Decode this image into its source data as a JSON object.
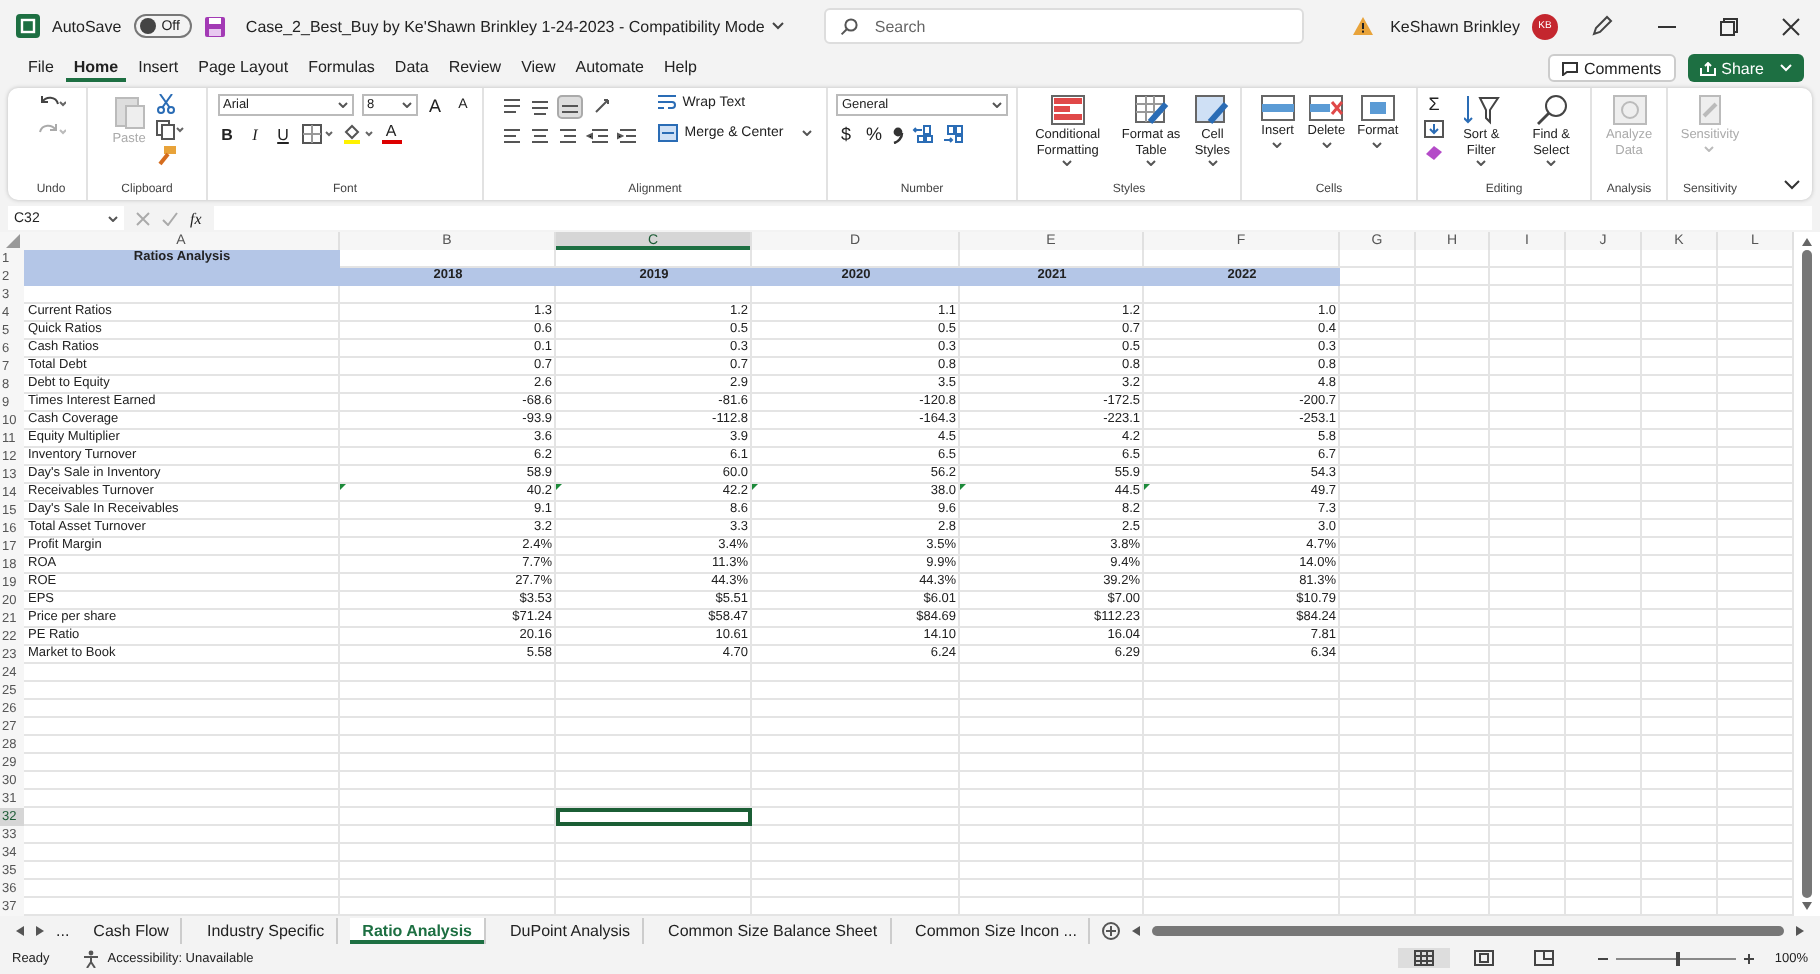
{
  "title_bar": {
    "autosave_label": "AutoSave",
    "autosave": {
      "on": false,
      "label": "Off"
    },
    "document_title": "Case_2_Best_Buy by Ke'Shawn Brinkley 1-24-2023  -  Compatibility Mode",
    "search": {
      "placeholder": "Search"
    },
    "user_name": "KeShawn Brinkley",
    "avatar_initials": "KB"
  },
  "menu_tabs": [
    {
      "label": "File",
      "selected": false
    },
    {
      "label": "Home",
      "selected": true
    },
    {
      "label": "Insert",
      "selected": false
    },
    {
      "label": "Page Layout",
      "selected": false
    },
    {
      "label": "Formulas",
      "selected": false
    },
    {
      "label": "Data",
      "selected": false
    },
    {
      "label": "Review",
      "selected": false
    },
    {
      "label": "View",
      "selected": false
    },
    {
      "label": "Automate",
      "selected": false
    },
    {
      "label": "Help",
      "selected": false
    }
  ],
  "comments_button": "Comments",
  "share_button": "Share",
  "ribbon": {
    "undo": {
      "label": "Undo"
    },
    "clipboard": {
      "label": "Clipboard",
      "paste": "Paste"
    },
    "font": {
      "label": "Font",
      "font_name": "Arial",
      "font_size": "8",
      "grow": "A",
      "shrink": "A",
      "bold": "B",
      "italic": "I",
      "underline": "U",
      "font_color": "A"
    },
    "alignment": {
      "label": "Alignment",
      "wrap_text": "Wrap Text",
      "merge_center": "Merge & Center"
    },
    "number": {
      "label": "Number",
      "format": "General",
      "currency": "$",
      "percent": "%"
    },
    "styles": {
      "label": "Styles",
      "buttons": [
        "Conditional Formatting",
        "Format as Table",
        "Cell Styles"
      ]
    },
    "cells": {
      "label": "Cells",
      "buttons": [
        "Insert",
        "Delete",
        "Format"
      ]
    },
    "editing": {
      "label": "Editing",
      "sum": "Σ",
      "buttons": [
        "Sort & Filter",
        "Find & Select"
      ]
    },
    "analysis": {
      "label": "Analysis",
      "button": {
        "label": "Analyze Data",
        "disabled": true
      }
    },
    "sensitivity": {
      "label": "Sensitivity",
      "button": {
        "label": "Sensitivity",
        "disabled": true
      }
    }
  },
  "formula_bar": {
    "name_box": "C32",
    "fx": "fx"
  },
  "sheet": {
    "columns": [
      {
        "label": "A",
        "selected": false
      },
      {
        "label": "B",
        "selected": false
      },
      {
        "label": "C",
        "selected": true
      },
      {
        "label": "D",
        "selected": false
      },
      {
        "label": "E",
        "selected": false
      },
      {
        "label": "F",
        "selected": false
      },
      {
        "label": "G",
        "selected": false
      },
      {
        "label": "H",
        "selected": false
      },
      {
        "label": "I",
        "selected": false
      },
      {
        "label": "J",
        "selected": false
      },
      {
        "label": "K",
        "selected": false
      },
      {
        "label": "L",
        "selected": false
      }
    ],
    "rows": [
      {
        "number": "1",
        "kind": "title",
        "selected": false,
        "title": "Ratios Analysis"
      },
      {
        "number": "2",
        "kind": "years",
        "selected": false,
        "years": [
          "2018",
          "2019",
          "2020",
          "2021",
          "2022"
        ]
      },
      {
        "number": "3",
        "kind": "blank",
        "selected": false
      },
      {
        "number": "4",
        "kind": "data",
        "selected": false,
        "flagged": false,
        "label": "Current Ratios",
        "values": [
          "1.3",
          "1.2",
          "1.1",
          "1.2",
          "1.0"
        ]
      },
      {
        "number": "5",
        "kind": "data",
        "selected": false,
        "flagged": false,
        "label": "Quick Ratios",
        "values": [
          "0.6",
          "0.5",
          "0.5",
          "0.7",
          "0.4"
        ]
      },
      {
        "number": "6",
        "kind": "data",
        "selected": false,
        "flagged": false,
        "label": "Cash Ratios",
        "values": [
          "0.1",
          "0.3",
          "0.3",
          "0.5",
          "0.3"
        ]
      },
      {
        "number": "7",
        "kind": "data",
        "selected": false,
        "flagged": false,
        "label": "Total Debt",
        "values": [
          "0.7",
          "0.7",
          "0.8",
          "0.8",
          "0.8"
        ]
      },
      {
        "number": "8",
        "kind": "data",
        "selected": false,
        "flagged": false,
        "label": "Debt to Equity",
        "values": [
          "2.6",
          "2.9",
          "3.5",
          "3.2",
          "4.8"
        ]
      },
      {
        "number": "9",
        "kind": "data",
        "selected": false,
        "flagged": false,
        "label": "Times Interest Earned",
        "values": [
          "-68.6",
          "-81.6",
          "-120.8",
          "-172.5",
          "-200.7"
        ]
      },
      {
        "number": "10",
        "kind": "data",
        "selected": false,
        "flagged": false,
        "label": "Cash Coverage",
        "values": [
          "-93.9",
          "-112.8",
          "-164.3",
          "-223.1",
          "-253.1"
        ]
      },
      {
        "number": "11",
        "kind": "data",
        "selected": false,
        "flagged": false,
        "label": "Equity Multiplier",
        "values": [
          "3.6",
          "3.9",
          "4.5",
          "4.2",
          "5.8"
        ]
      },
      {
        "number": "12",
        "kind": "data",
        "selected": false,
        "flagged": false,
        "label": "Inventory Turnover",
        "values": [
          "6.2",
          "6.1",
          "6.5",
          "6.5",
          "6.7"
        ]
      },
      {
        "number": "13",
        "kind": "data",
        "selected": false,
        "flagged": false,
        "label": "Day's Sale in Inventory",
        "values": [
          "58.9",
          "60.0",
          "56.2",
          "55.9",
          "54.3"
        ]
      },
      {
        "number": "14",
        "kind": "data",
        "selected": false,
        "flagged": true,
        "label": "Receivables Turnover",
        "values": [
          "40.2",
          "42.2",
          "38.0",
          "44.5",
          "49.7"
        ]
      },
      {
        "number": "15",
        "kind": "data",
        "selected": false,
        "flagged": false,
        "label": "Day's Sale In Receivables",
        "values": [
          "9.1",
          "8.6",
          "9.6",
          "8.2",
          "7.3"
        ]
      },
      {
        "number": "16",
        "kind": "data",
        "selected": false,
        "flagged": false,
        "label": "Total Asset Turnover",
        "values": [
          "3.2",
          "3.3",
          "2.8",
          "2.5",
          "3.0"
        ]
      },
      {
        "number": "17",
        "kind": "data",
        "selected": false,
        "flagged": false,
        "label": "Profit Margin",
        "values": [
          "2.4%",
          "3.4%",
          "3.5%",
          "3.8%",
          "4.7%"
        ]
      },
      {
        "number": "18",
        "kind": "data",
        "selected": false,
        "flagged": false,
        "label": "ROA",
        "values": [
          "7.7%",
          "11.3%",
          "9.9%",
          "9.4%",
          "14.0%"
        ]
      },
      {
        "number": "19",
        "kind": "data",
        "selected": false,
        "flagged": false,
        "label": "ROE",
        "values": [
          "27.7%",
          "44.3%",
          "44.3%",
          "39.2%",
          "81.3%"
        ]
      },
      {
        "number": "20",
        "kind": "data",
        "selected": false,
        "flagged": false,
        "label": "EPS",
        "values": [
          "$3.53",
          "$5.51",
          "$6.01",
          "$7.00",
          "$10.79"
        ]
      },
      {
        "number": "21",
        "kind": "data",
        "selected": false,
        "flagged": false,
        "label": "Price per share",
        "values": [
          "$71.24",
          "$58.47",
          "$84.69",
          "$112.23",
          "$84.24"
        ]
      },
      {
        "number": "22",
        "kind": "data",
        "selected": false,
        "flagged": false,
        "label": "PE Ratio",
        "values": [
          "20.16",
          "10.61",
          "14.10",
          "16.04",
          "7.81"
        ]
      },
      {
        "number": "23",
        "kind": "data",
        "selected": false,
        "flagged": false,
        "label": "Market to Book",
        "values": [
          "5.58",
          "4.70",
          "6.24",
          "6.29",
          "6.34"
        ]
      },
      {
        "number": "24",
        "kind": "blank",
        "selected": false
      },
      {
        "number": "25",
        "kind": "blank",
        "selected": false
      },
      {
        "number": "26",
        "kind": "blank",
        "selected": false
      },
      {
        "number": "27",
        "kind": "blank",
        "selected": false
      },
      {
        "number": "28",
        "kind": "blank",
        "selected": false
      },
      {
        "number": "29",
        "kind": "blank",
        "selected": false
      },
      {
        "number": "30",
        "kind": "blank",
        "selected": false
      },
      {
        "number": "31",
        "kind": "blank",
        "selected": false
      },
      {
        "number": "32",
        "kind": "blank",
        "selected": true
      },
      {
        "number": "33",
        "kind": "blank",
        "selected": false
      },
      {
        "number": "34",
        "kind": "blank",
        "selected": false
      },
      {
        "number": "35",
        "kind": "blank",
        "selected": false
      },
      {
        "number": "36",
        "kind": "blank",
        "selected": false
      },
      {
        "number": "37",
        "kind": "blank",
        "selected": false
      }
    ]
  },
  "sheet_tabs": {
    "more": "...",
    "tabs": [
      {
        "label": "Cash Flow",
        "selected": false
      },
      {
        "label": "Industry Specific",
        "selected": false
      },
      {
        "label": "Ratio Analysis",
        "selected": true
      },
      {
        "label": "DuPoint Analysis",
        "selected": false
      },
      {
        "label": "Common Size Balance Sheet",
        "selected": false
      },
      {
        "label": "Common Size Incon ...",
        "selected": false
      }
    ]
  },
  "status_bar": {
    "mode": "Ready",
    "accessibility": "Accessibility: Unavailable",
    "zoom_slider": {
      "level": 0.5
    },
    "zoom": "100%"
  }
}
